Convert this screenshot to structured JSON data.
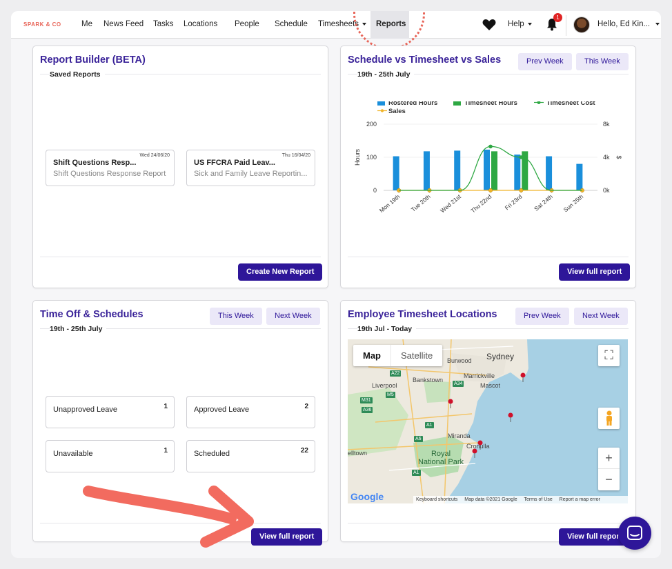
{
  "nav": {
    "brand": "SPARK & CO",
    "items": [
      "Me",
      "News Feed",
      "Tasks",
      "Locations",
      "People",
      "Schedule",
      "Timesheets",
      "Reports"
    ],
    "active": "Reports",
    "help": "Help",
    "notification_count": "1",
    "user_greeting": "Hello, Ed Kin..."
  },
  "report_builder": {
    "title": "Report Builder (BETA)",
    "subtitle": "Saved Reports",
    "reports": [
      {
        "date": "Wed 24/06/20",
        "name": "Shift Questions Resp...",
        "desc": "Shift Questions Response Report"
      },
      {
        "date": "Thu 16/04/20",
        "name": "US FFCRA Paid Leav...",
        "desc": "Sick and Family Leave Reportin..."
      }
    ],
    "create_label": "Create New Report"
  },
  "schedule_chart": {
    "title": "Schedule vs Timesheet vs Sales",
    "subtitle": "19th - 25th July",
    "prev_label": "Prev Week",
    "this_label": "This Week",
    "view_label": "View full report"
  },
  "time_off": {
    "title": "Time Off & Schedules",
    "subtitle": "19th - 25th July",
    "this_label": "This Week",
    "next_label": "Next Week",
    "stats": [
      {
        "label": "Unapproved Leave",
        "count": "1"
      },
      {
        "label": "Approved Leave",
        "count": "2"
      },
      {
        "label": "Unavailable",
        "count": "1"
      },
      {
        "label": "Scheduled",
        "count": "22"
      }
    ],
    "view_label": "View full report"
  },
  "locations": {
    "title": "Employee Timesheet Locations",
    "subtitle": "19th Jul - Today",
    "prev_label": "Prev Week",
    "next_label": "Next Week",
    "view_label": "View full report",
    "map_tab_map": "Map",
    "map_tab_satellite": "Satellite",
    "place_labels": {
      "sydney": "Sydney",
      "burwood": "Burwood",
      "bankstown": "Bankstown",
      "marrickville": "Marrickville",
      "mascot": "Mascot",
      "liverpool": "Liverpool",
      "miranda": "Miranda",
      "cronulla": "Cronulla",
      "elltown": "elltown",
      "royal_park": "Royal National Park"
    },
    "road_shields": [
      "A22",
      "A34",
      "M5",
      "A36",
      "M31",
      "A6",
      "A1",
      "A1"
    ],
    "google": "Google",
    "footer": [
      "Keyboard shortcuts",
      "Map data ©2021 Google",
      "Terms of Use",
      "Report a map error"
    ]
  },
  "chart_data": {
    "type": "bar",
    "categories": [
      "Mon 19th",
      "Tue 20th",
      "Wed 21st",
      "Thu 22nd",
      "Fri 23rd",
      "Sat 24th",
      "Sun 25th"
    ],
    "series": [
      {
        "name": "Rostered Hours",
        "type": "bar",
        "axis": "left",
        "color": "#1a8fdb",
        "values": [
          103,
          118,
          120,
          123,
          108,
          103,
          80
        ]
      },
      {
        "name": "Timesheet Hours",
        "type": "bar",
        "axis": "left",
        "color": "#2ea843",
        "values": [
          0,
          0,
          0,
          118,
          118,
          0,
          0
        ]
      },
      {
        "name": "Timesheet Cost",
        "type": "line",
        "axis": "right",
        "color": "#2ea843",
        "values": [
          0,
          0,
          0,
          5300,
          4000,
          0,
          0
        ]
      },
      {
        "name": "Sales",
        "type": "line",
        "axis": "right",
        "color": "#f0b429",
        "values": [
          0,
          0,
          0,
          0,
          0,
          0,
          0
        ]
      }
    ],
    "ylabel": "Hours",
    "y2label": "$",
    "ylim": [
      0,
      200
    ],
    "y2lim": [
      0,
      8000
    ],
    "yticks": [
      "0",
      "100",
      "200"
    ],
    "y2ticks": [
      "0k",
      "4k",
      "8k"
    ],
    "legend": "top"
  }
}
